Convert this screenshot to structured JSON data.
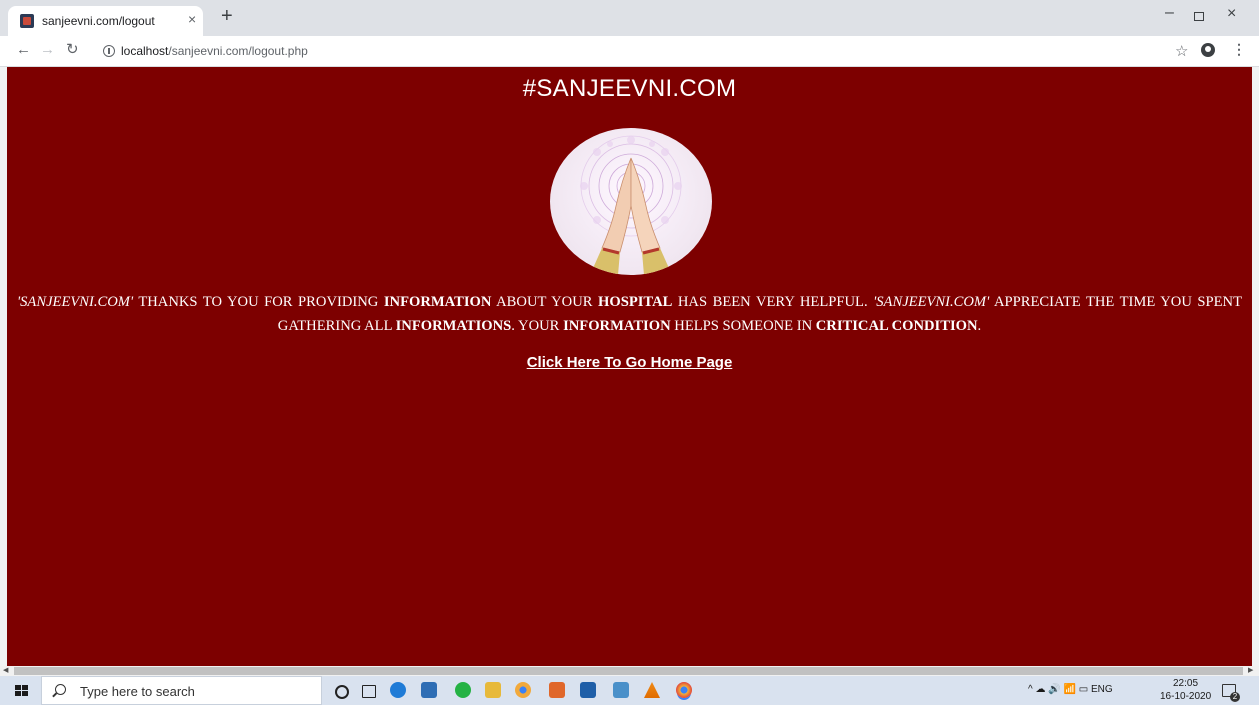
{
  "browser": {
    "tab_title": "sanjeevni.com/logout",
    "tab_close": "×",
    "new_tab": "+",
    "url_host": "localhost",
    "url_path": "/sanjeevni.com/logout.php",
    "window_min": "–",
    "window_close": "×"
  },
  "page": {
    "title": "#SANJEEVNI.COM",
    "message": [
      {
        "text": "'SANJEEVNI.COM'",
        "style": "italic"
      },
      {
        "text": " THANKS TO YOU FOR PROVIDING ",
        "style": "normal"
      },
      {
        "text": "INFORMATION",
        "style": "bold"
      },
      {
        "text": " ABOUT YOUR ",
        "style": "normal"
      },
      {
        "text": "HOSPITAL",
        "style": "bold"
      },
      {
        "text": " HAS BEEN VERY HELPFUL. ",
        "style": "normal"
      },
      {
        "text": "'SANJEEVNI.COM'",
        "style": "italic"
      },
      {
        "text": " APPRECIATE THE TIME YOU SPENT GATHERING ALL ",
        "style": "normal"
      },
      {
        "text": "INFORMATIONS",
        "style": "bold"
      },
      {
        "text": ". YOUR ",
        "style": "normal"
      },
      {
        "text": "INFORMATION",
        "style": "bold"
      },
      {
        "text": " HELPS SOMEONE IN ",
        "style": "normal"
      },
      {
        "text": "CRITICAL CONDITION",
        "style": "bold"
      },
      {
        "text": ".",
        "style": "normal"
      }
    ],
    "home_link": "Click Here To Go Home Page",
    "background_color": "#7d0000"
  },
  "taskbar": {
    "search_placeholder": "Type here to search",
    "tray_lang": "ENG",
    "time": "22:05",
    "date": "16-10-2020",
    "notification_count": "2"
  }
}
